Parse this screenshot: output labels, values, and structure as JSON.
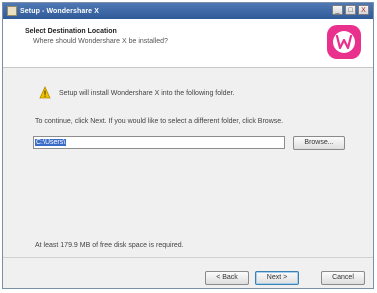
{
  "window": {
    "title": "Setup - Wondershare X",
    "minimize_glyph": "_",
    "maximize_glyph": "□",
    "close_glyph": "X"
  },
  "header": {
    "title": "Select Destination Location",
    "subtitle": "Where should Wondershare X be installed?",
    "logo_icon": "wondershare-logo",
    "logo_color": "#e8308c"
  },
  "body": {
    "info_icon": "warning-folder-icon",
    "info_text": "Setup will install Wondershare X into the following folder.",
    "continue_text": "To continue, click Next. If you would like to select a different folder, click Browse.",
    "path_value": "C:\\Users\\",
    "browse_label": "Browse...",
    "space_text": "At least 179.9 MB of free disk space is required."
  },
  "footer": {
    "back_label": "< Back",
    "next_label": "Next >",
    "cancel_label": "Cancel"
  }
}
